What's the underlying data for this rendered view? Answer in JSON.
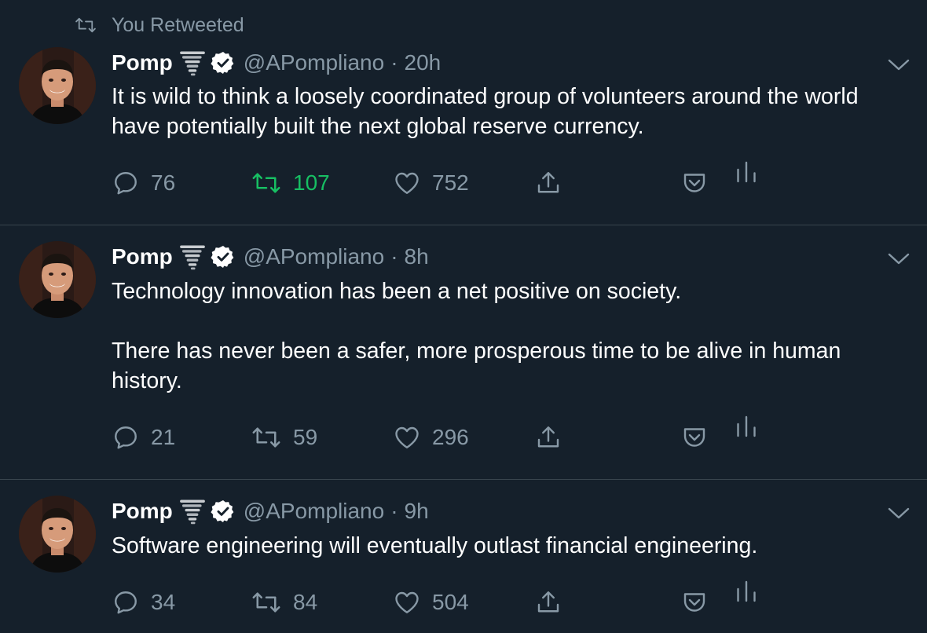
{
  "retweet_context": {
    "label": "You Retweeted"
  },
  "author": {
    "display_name": "Pomp",
    "handle": "@APompliano",
    "separator": "·"
  },
  "colors": {
    "background": "#15202b",
    "secondary_text": "#8899a6",
    "retweeted_green": "#17bf63",
    "verified_badge": "#ffffff",
    "divider": "#38444d"
  },
  "icons": {
    "retweet_context": "retweet-icon",
    "verified": "verified-badge-icon",
    "emoji": "tornado-emoji-icon",
    "more": "chevron-down-icon",
    "reply": "reply-icon",
    "retweet": "retweet-icon",
    "like": "heart-icon",
    "share": "share-icon",
    "save": "pocket-save-icon",
    "analytics": "analytics-icon"
  },
  "tweets": [
    {
      "time": "20h",
      "text": "It is wild to think a loosely coordinated group of volunteers around the world have potentially built the next global reserve currency.",
      "replies": "76",
      "retweets": "107",
      "likes": "752",
      "retweeted": true
    },
    {
      "time": "8h",
      "text": "Technology innovation has been a net positive on society.\n\nThere has never been a safer, more prosperous time to be alive in human history.",
      "replies": "21",
      "retweets": "59",
      "likes": "296",
      "retweeted": false
    },
    {
      "time": "9h",
      "text": "Software engineering will eventually outlast financial engineering.",
      "replies": "34",
      "retweets": "84",
      "likes": "504",
      "retweeted": false
    }
  ]
}
